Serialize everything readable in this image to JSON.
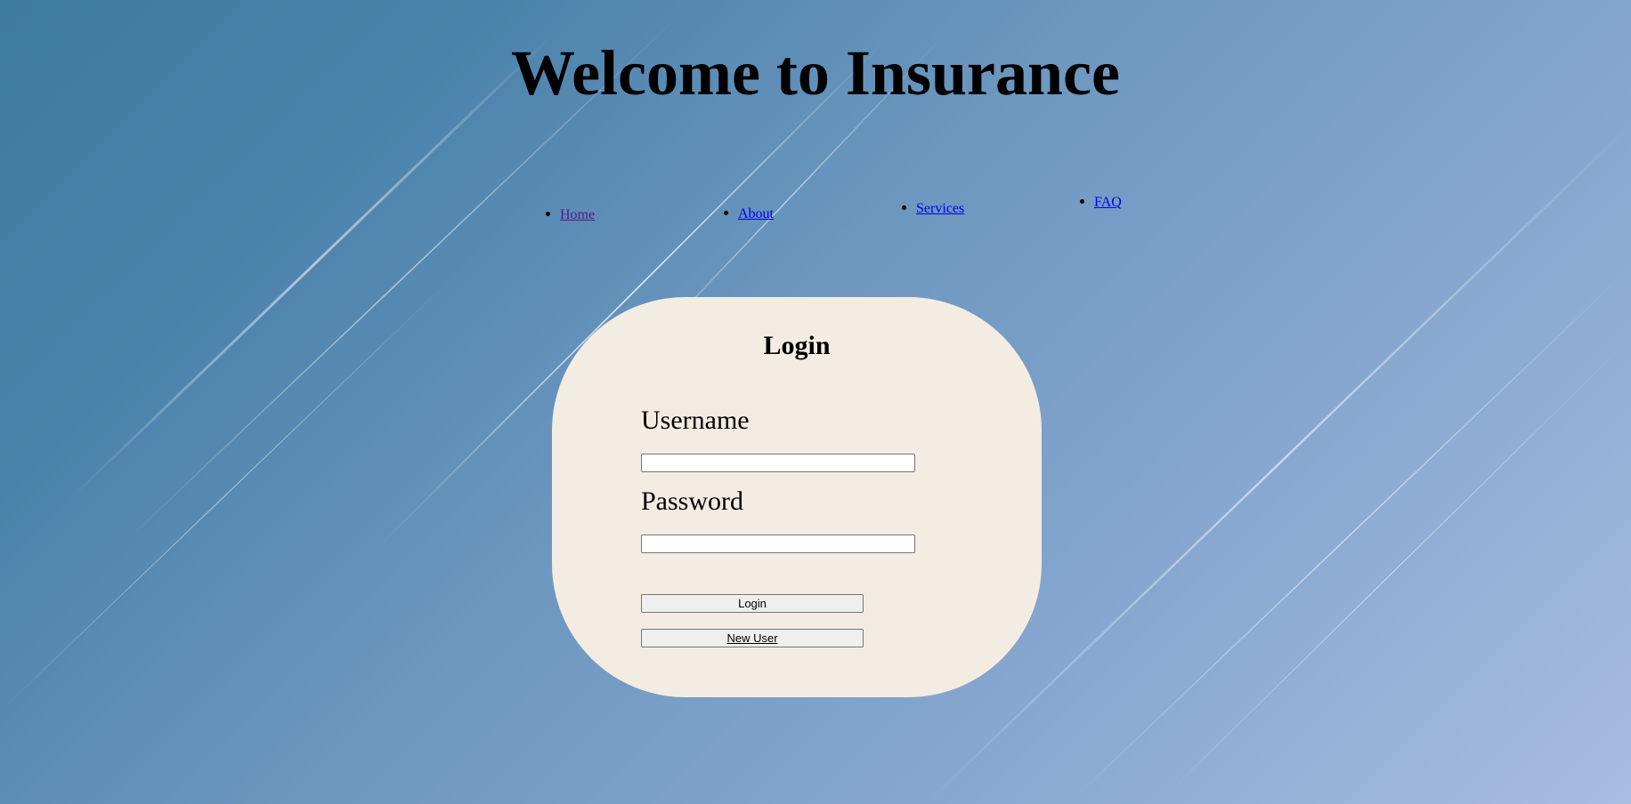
{
  "header": {
    "title": "Welcome to Insurance"
  },
  "nav": {
    "items": [
      {
        "label": "Home",
        "visited": true
      },
      {
        "label": "About",
        "visited": false
      },
      {
        "label": "Services",
        "visited": false
      },
      {
        "label": "FAQ",
        "visited": false
      }
    ]
  },
  "login": {
    "heading": "Login",
    "username_label": "Username",
    "username_value": "",
    "password_label": "Password",
    "password_value": "",
    "login_button": "Login",
    "new_user_button": "New User"
  },
  "colors": {
    "card_background": "#f3ece2",
    "link": "#0000ee",
    "link_visited": "#551a8b",
    "background_start": "#3f7aa0",
    "background_end": "#a8bce0"
  }
}
